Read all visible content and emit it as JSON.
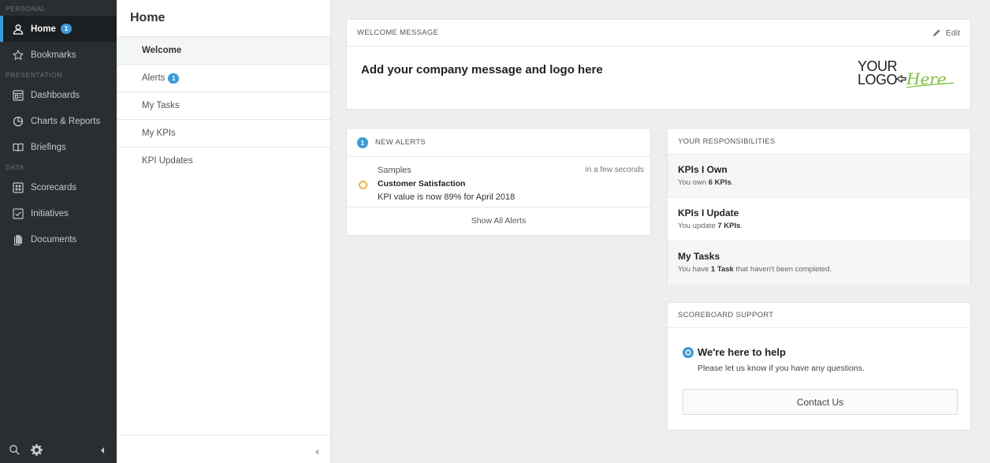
{
  "sidebar": {
    "sections": [
      {
        "label": "PERSONAL"
      },
      {
        "label": "PRESENTATION"
      },
      {
        "label": "DATA"
      }
    ],
    "items": [
      {
        "label": "Home",
        "icon": "user-icon",
        "badge": "1"
      },
      {
        "label": "Bookmarks",
        "icon": "star-icon"
      },
      {
        "label": "Dashboards",
        "icon": "dashboard-icon"
      },
      {
        "label": "Charts & Reports",
        "icon": "pie-chart-icon"
      },
      {
        "label": "Briefings",
        "icon": "book-icon"
      },
      {
        "label": "Scorecards",
        "icon": "scorecard-icon"
      },
      {
        "label": "Initiatives",
        "icon": "checkbox-icon"
      },
      {
        "label": "Documents",
        "icon": "documents-icon"
      }
    ],
    "active": "Home"
  },
  "subnav": {
    "title": "Home",
    "items": [
      {
        "label": "Welcome"
      },
      {
        "label": "Alerts",
        "badge": "1"
      },
      {
        "label": "My Tasks"
      },
      {
        "label": "My KPIs"
      },
      {
        "label": "KPI Updates"
      }
    ]
  },
  "welcome": {
    "header": "WELCOME MESSAGE",
    "edit_label": "Edit",
    "message": "Add your company message and logo here",
    "logo_text": {
      "line1": "YOUR",
      "line2": "LOGO",
      "script": "Here"
    }
  },
  "alerts": {
    "badge": "1",
    "header": "NEW ALERTS",
    "items": [
      {
        "source": "Samples",
        "time": "in a few seconds",
        "title": "Customer Satisfaction",
        "description": "KPI value is now 89% for April 2018"
      }
    ],
    "show_all_label": "Show All Alerts"
  },
  "responsibilities": {
    "header": "YOUR RESPONSIBILITIES",
    "items": [
      {
        "title": "KPIs I Own",
        "pre": "You own ",
        "bold": "6 KPIs",
        "post": "."
      },
      {
        "title": "KPIs I Update",
        "pre": "You update ",
        "bold": "7 KPIs",
        "post": "."
      },
      {
        "title": "My Tasks",
        "pre": "You have ",
        "bold": "1 Task",
        "post": " that haven't been completed."
      }
    ]
  },
  "support": {
    "header": "SCOREBOARD SUPPORT",
    "help_title": "We're here to help",
    "help_sub": "Please let us know if you have any questions.",
    "contact_label": "Contact Us"
  },
  "colors": {
    "accent": "#3a9bd9",
    "sidebar_bg": "#2b2e30",
    "alert_ring": "#f3b43c",
    "logo_green": "#7cbf3a"
  }
}
